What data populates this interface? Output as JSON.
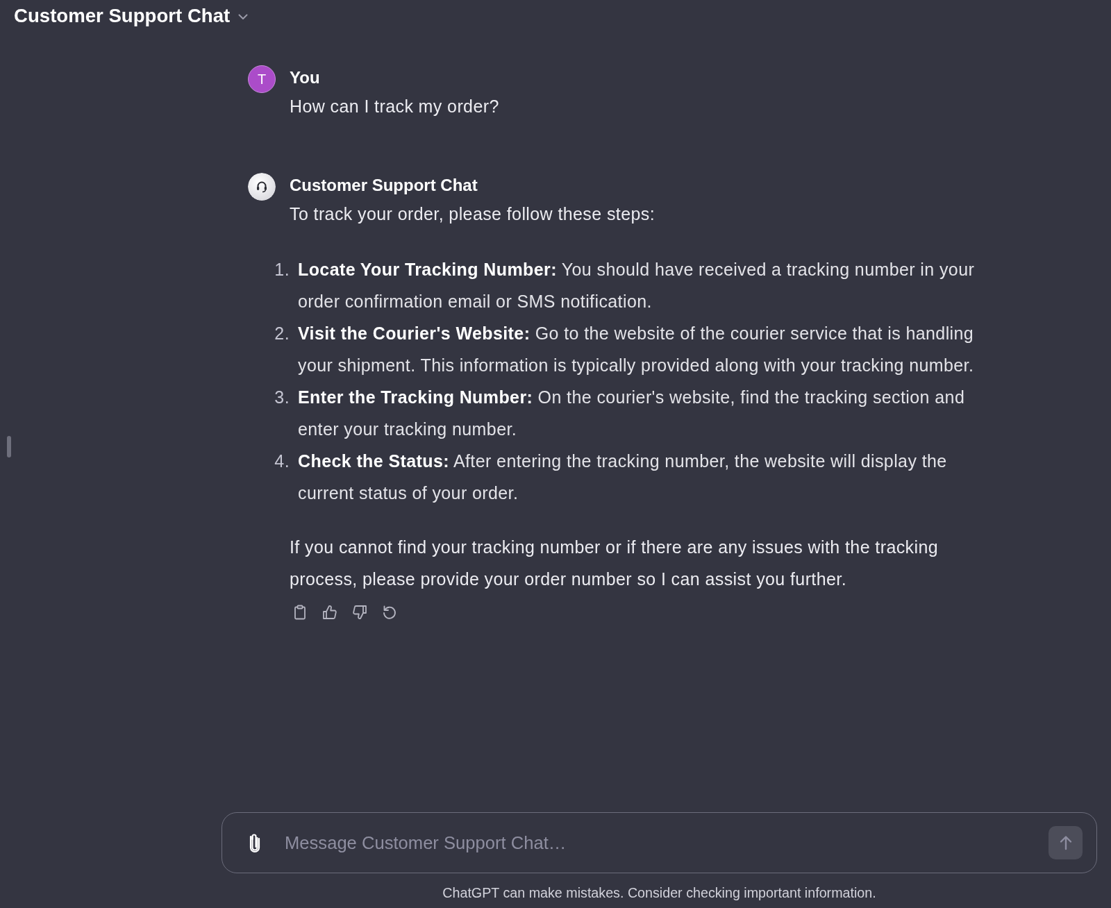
{
  "header": {
    "title": "Customer Support Chat"
  },
  "messages": [
    {
      "kind": "user",
      "avatar_letter": "T",
      "author": "You",
      "intro": "How can I track my order?"
    },
    {
      "kind": "assistant",
      "author": "Customer Support Chat",
      "intro": "To track your order, please follow these steps:",
      "steps": [
        {
          "number": "1.",
          "text": "**Locate Your Tracking Number:** You should have received a tracking number in your order confirmation email or SMS notification."
        },
        {
          "number": "2.",
          "text": "**Visit the Courier's Website:** Go to the website of the courier service that is handling your shipment. This information is typically provided along with your tracking number."
        },
        {
          "number": "3.",
          "text": "**Enter the Tracking Number:** On the courier's website, find the tracking section and enter your tracking number."
        },
        {
          "number": "4.",
          "text": "**Check the Status:** After entering the tracking number, the website will display the current status of your order."
        }
      ],
      "closing": "If you cannot find your tracking number or if there are any issues with the tracking process, please provide your order number so I can assist you further."
    }
  ],
  "composer": {
    "placeholder": "Message Customer Support Chat…",
    "send_disabled": true
  },
  "footer": "ChatGPT can make mistakes. Consider checking important information."
}
